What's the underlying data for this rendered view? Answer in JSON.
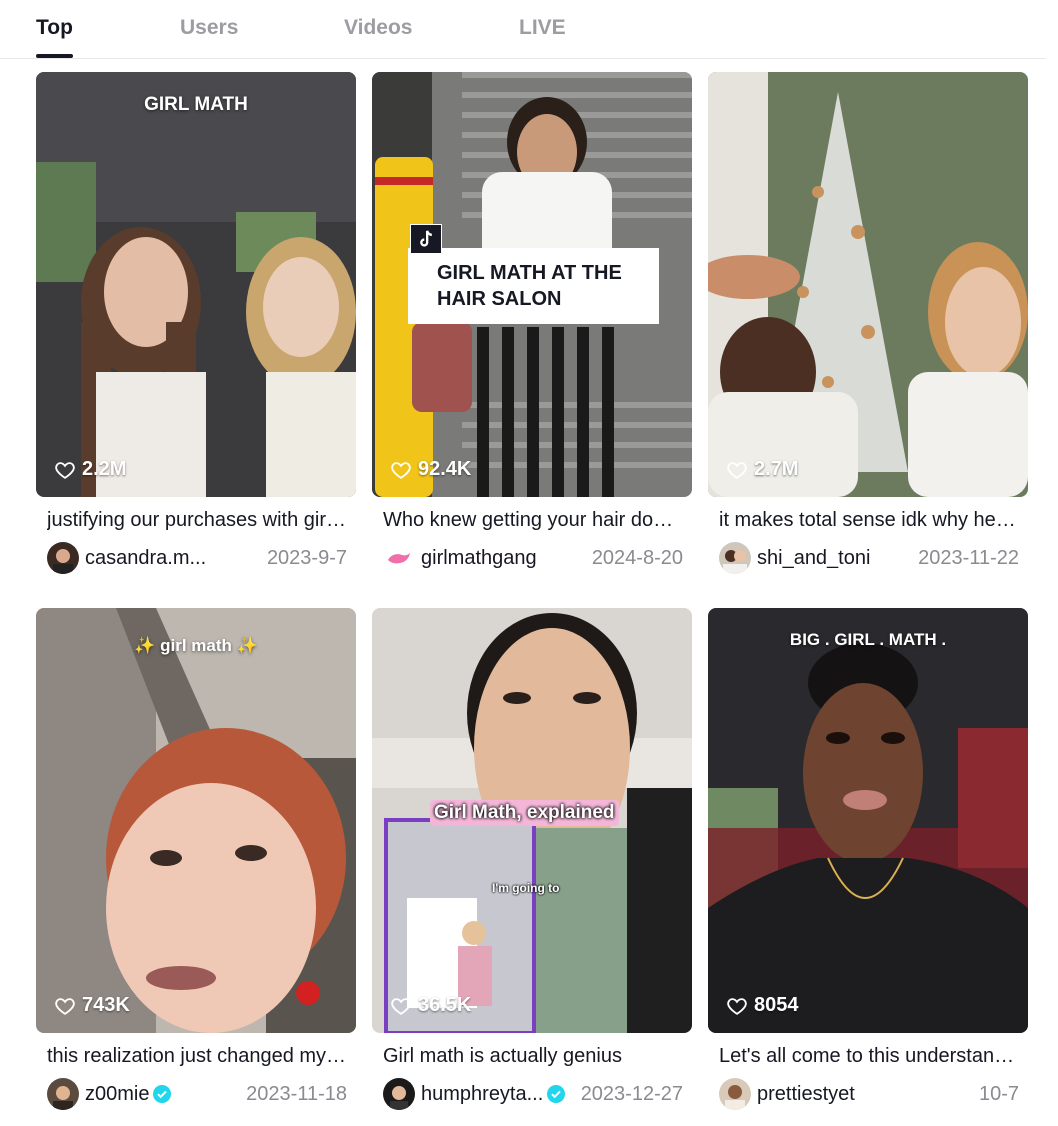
{
  "tabs": [
    {
      "label": "Top",
      "active": true
    },
    {
      "label": "Users",
      "active": false
    },
    {
      "label": "Videos",
      "active": false
    },
    {
      "label": "LIVE",
      "active": false
    }
  ],
  "videos": [
    {
      "likes": "2.2M",
      "caption": "justifying our purchases with girl math",
      "username": "casandra.m...",
      "date": "2023-9-7",
      "overlay": "GIRL MATH",
      "verified": false
    },
    {
      "likes": "92.4K",
      "caption": "Who knew getting your hair done was free",
      "username": "girlmathgang",
      "date": "2024-8-20",
      "overlay": "GIRL MATH AT THE HAIR SALON",
      "overlay_line1": "GIRL MATH AT THE",
      "overlay_line2": "HAIR SALON",
      "verified": false
    },
    {
      "likes": "2.7M",
      "caption": "it makes total sense idk why he's confused",
      "username": "shi_and_toni",
      "date": "2023-11-22",
      "verified": false
    },
    {
      "likes": "743K",
      "caption": "this realization just changed my life",
      "username": "z00mie",
      "date": "2023-11-18",
      "overlay": "✨ girl math ✨",
      "verified": true
    },
    {
      "likes": "36.5K",
      "caption": "Girl math is actually genius",
      "username": "humphreyta...",
      "date": "2023-12-27",
      "overlay": "Girl Math, explained",
      "overlay_sub": "I'm going to",
      "verified": true
    },
    {
      "likes": "8054",
      "caption": "Let's all come to this understanding",
      "username": "prettiestyet",
      "date": "10-7",
      "overlay": "BIG . GIRL . MATH .",
      "verified": false
    }
  ],
  "colors": {
    "accent_verified": "#20d5ec",
    "text_primary": "#161823",
    "text_secondary": "#8a8b91"
  },
  "icons": [
    "heart-outline-icon",
    "verified-badge-icon",
    "tiktok-logo-icon"
  ]
}
